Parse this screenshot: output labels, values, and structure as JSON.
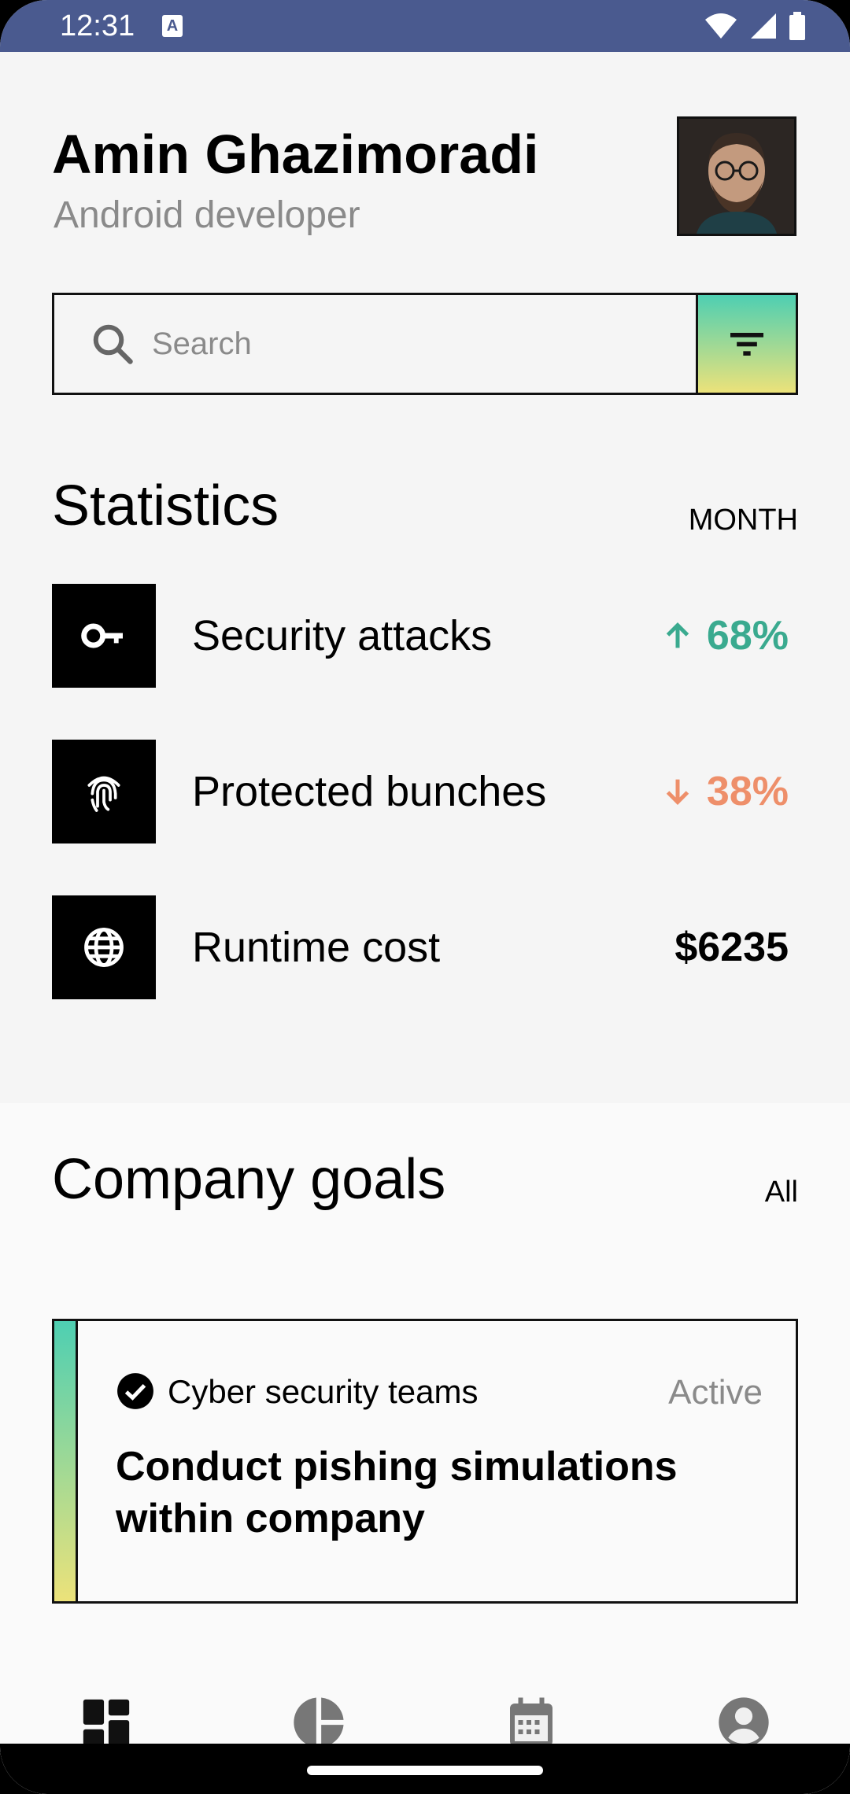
{
  "status_bar": {
    "time": "12:31",
    "notification_glyph": "A"
  },
  "profile": {
    "name": "Amin Ghazimoradi",
    "role": "Android developer"
  },
  "search": {
    "placeholder": "Search",
    "value": ""
  },
  "statistics": {
    "title": "Statistics",
    "period": "MONTH",
    "items": [
      {
        "icon": "key-icon",
        "label": "Security attacks",
        "trend": "up",
        "value": "68%",
        "color": "#3aaa8f"
      },
      {
        "icon": "fingerprint-icon",
        "label": "Protected bunches",
        "trend": "down",
        "value": "38%",
        "color": "#ee8f6a"
      },
      {
        "icon": "globe-icon",
        "label": "Runtime cost",
        "trend": "none",
        "value": "$6235",
        "color": "#000000"
      }
    ]
  },
  "goals": {
    "title": "Company goals",
    "filter": "All",
    "card": {
      "team": "Cyber security teams",
      "status": "Active",
      "title": "Conduct pishing simulations within company"
    }
  },
  "nav": [
    "dashboard-icon",
    "pie-chart-icon",
    "calendar-icon",
    "account-icon"
  ],
  "colors": {
    "status_bar": "#4a5a8f",
    "gradient_top": "#4ecfb2",
    "gradient_bottom": "#ece27a"
  }
}
